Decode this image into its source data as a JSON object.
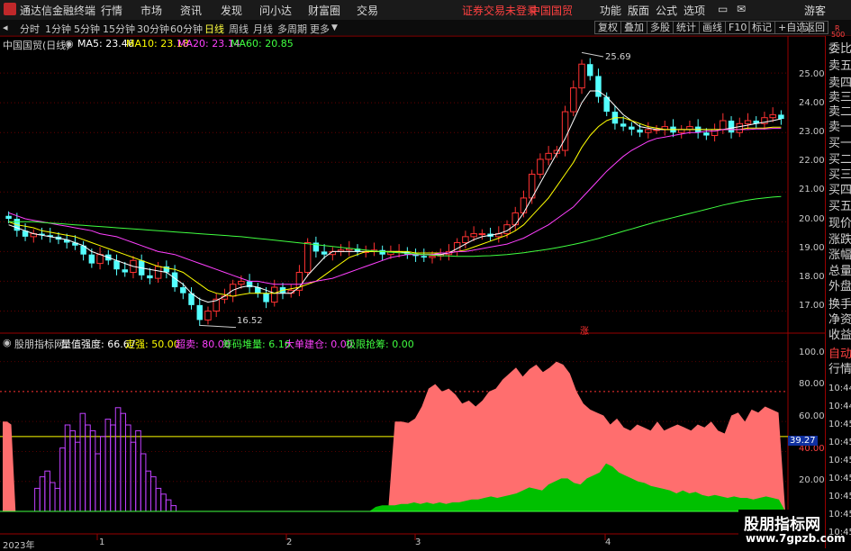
{
  "titlebar": {
    "app_title": "通达信金融终端",
    "menu": [
      "行情",
      "市场",
      "资讯",
      "发现",
      "问小达",
      "财富圈",
      "交易"
    ],
    "login_status": "证券交易未登录",
    "stock_name": "中国国贸",
    "right_menu": [
      "功能",
      "版面",
      "公式",
      "选项"
    ],
    "guest": "游客"
  },
  "periodbar": {
    "periods": [
      "分时",
      "1分钟",
      "5分钟",
      "15分钟",
      "30分钟",
      "60分钟",
      "日线",
      "周线",
      "月线",
      "多周期",
      "更多"
    ],
    "selected": "日线",
    "tools": [
      "复权",
      "叠加",
      "多股",
      "统计",
      "画线",
      "F10",
      "标记",
      "+自选",
      "返回"
    ]
  },
  "main_chart_header": {
    "title": "中国国贸(日线)",
    "ma": [
      {
        "label": "MA5: 23.46",
        "color": "#ffffff"
      },
      {
        "label": "MA10: 23.18",
        "color": "#ffff00"
      },
      {
        "label": "MA20: 23.14",
        "color": "#ff40ff"
      },
      {
        "label": "MA60: 20.85",
        "color": "#40ff40"
      }
    ]
  },
  "indicator_header": {
    "name": "股朋指标网",
    "items": [
      {
        "label": "量值强度: 66.67",
        "color": "#ffffff"
      },
      {
        "label": "走强: 50.00",
        "color": "#ffff00"
      },
      {
        "label": "超卖: 80.00",
        "color": "#ff40ff"
      },
      {
        "label": "筹码堆量: 6.16",
        "color": "#40ff40"
      },
      {
        "label": "大单建仓: 0.00",
        "color": "#ff40ff"
      },
      {
        "label": "极限抢筹: 0.00",
        "color": "#40ff40"
      }
    ]
  },
  "price_axis": [
    "25.00",
    "24.00",
    "23.00",
    "22.00",
    "21.00",
    "20.00",
    "19.00",
    "18.00",
    "17.00"
  ],
  "indicator_axis": [
    "100.0",
    "80.00",
    "60.00",
    "40.00",
    "20.00"
  ],
  "indicator_axis_highlight": "39.27",
  "high_label": "25.69",
  "low_label": "16.52",
  "zhang_marker": "涨",
  "date_axis": [
    "2023年",
    "1",
    "2",
    "3",
    "4"
  ],
  "right_panel": [
    "委比",
    "卖五",
    "卖四",
    "卖三",
    "卖二",
    "卖一",
    "买一",
    "买二",
    "买三",
    "买四",
    "买五",
    "现价",
    "涨跌",
    "涨幅",
    "总量",
    "外盘",
    "换手",
    "净资",
    "收益"
  ],
  "right_panel_lower": [
    "自动",
    "行情"
  ],
  "right_panel_times": [
    "10:44",
    "10:44",
    "10:45",
    "10:45",
    "10:45",
    "10:45",
    "10:45",
    "10:45",
    "10:45"
  ],
  "r_badge": "R",
  "r_badge_num": "500",
  "watermark": {
    "title": "股朋指标网",
    "url": "www.7gpzb.com"
  },
  "colors": {
    "up": "#ff3232",
    "down": "#54ffff",
    "ma5": "#ffffff",
    "ma10": "#ffff00",
    "ma20": "#ff40ff",
    "ma60": "#40ff40",
    "accent": "#900000"
  },
  "chart_data": {
    "type": "candlestick",
    "ylim": [
      16.5,
      25.7
    ],
    "close": [
      20.1,
      19.7,
      19.5,
      19.6,
      19.55,
      19.5,
      19.4,
      19.3,
      19.2,
      18.9,
      18.6,
      18.9,
      18.7,
      18.4,
      18.3,
      18.7,
      18.2,
      18.1,
      18.5,
      18.3,
      17.8,
      17.6,
      17.2,
      16.7,
      17.0,
      17.4,
      17.5,
      17.9,
      18.0,
      17.8,
      17.6,
      17.3,
      17.8,
      17.6,
      17.7,
      18.3,
      19.3,
      19.0,
      18.9,
      19.0,
      19.05,
      19.1,
      19.0,
      19.0,
      19.05,
      18.9,
      19.0,
      19.0,
      18.9,
      18.85,
      18.8,
      18.85,
      18.9,
      19.0,
      19.3,
      19.5,
      19.6,
      19.6,
      19.5,
      19.6,
      19.9,
      20.3,
      20.8,
      21.6,
      22.1,
      22.3,
      22.4,
      23.7,
      24.5,
      25.3,
      24.9,
      24.2,
      23.7,
      23.3,
      23.2,
      23.1,
      23.0,
      23.1,
      23.1,
      23.2,
      23.0,
      23.1,
      23.2,
      23.0,
      22.9,
      23.1,
      23.4,
      23.0,
      23.3,
      23.4,
      23.3,
      23.5,
      23.6,
      23.46
    ],
    "series": [
      {
        "name": "MA5",
        "values": [
          19.9,
          19.8,
          19.7,
          19.6,
          19.55,
          19.5,
          19.45,
          19.4,
          19.3,
          19.2,
          19.0,
          18.9,
          18.8,
          18.7,
          18.6,
          18.5,
          18.45,
          18.4,
          18.35,
          18.3,
          18.1,
          17.9,
          17.6,
          17.4,
          17.3,
          17.35,
          17.5,
          17.7,
          17.8,
          17.85,
          17.8,
          17.7,
          17.6,
          17.6,
          17.6,
          17.8,
          18.2,
          18.5,
          18.8,
          19.0,
          19.0,
          19.0,
          19.0,
          19.0,
          19.0,
          19.0,
          19.0,
          19.0,
          18.95,
          18.9,
          18.9,
          18.9,
          18.9,
          18.95,
          19.1,
          19.25,
          19.4,
          19.5,
          19.55,
          19.6,
          19.7,
          19.9,
          20.3,
          20.8,
          21.3,
          21.8,
          22.3,
          22.8,
          23.4,
          24.0,
          24.4,
          24.4,
          24.2,
          23.9,
          23.6,
          23.4,
          23.2,
          23.15,
          23.1,
          23.1,
          23.1,
          23.1,
          23.1,
          23.1,
          23.1,
          23.1,
          23.1,
          23.15,
          23.2,
          23.25,
          23.3,
          23.35,
          23.4,
          23.46
        ]
      },
      {
        "name": "MA10",
        "values": [
          20.0,
          19.9,
          19.85,
          19.8,
          19.7,
          19.65,
          19.6,
          19.55,
          19.5,
          19.4,
          19.3,
          19.2,
          19.1,
          19.0,
          18.9,
          18.8,
          18.7,
          18.6,
          18.5,
          18.45,
          18.4,
          18.3,
          18.1,
          17.9,
          17.7,
          17.6,
          17.55,
          17.5,
          17.55,
          17.6,
          17.6,
          17.6,
          17.6,
          17.7,
          17.75,
          17.8,
          17.9,
          18.0,
          18.2,
          18.4,
          18.6,
          18.8,
          18.9,
          19.0,
          19.0,
          19.0,
          19.0,
          19.0,
          19.0,
          18.95,
          18.95,
          18.95,
          18.95,
          18.95,
          19.0,
          19.05,
          19.15,
          19.25,
          19.35,
          19.45,
          19.55,
          19.7,
          19.9,
          20.2,
          20.5,
          20.8,
          21.2,
          21.6,
          22.0,
          22.5,
          22.9,
          23.2,
          23.4,
          23.5,
          23.5,
          23.4,
          23.3,
          23.2,
          23.15,
          23.1,
          23.1,
          23.1,
          23.1,
          23.1,
          23.1,
          23.1,
          23.1,
          23.1,
          23.1,
          23.15,
          23.15,
          23.15,
          23.18,
          23.18
        ]
      },
      {
        "name": "MA20",
        "values": [
          20.3,
          20.2,
          20.1,
          20.05,
          20.0,
          19.95,
          19.9,
          19.85,
          19.8,
          19.75,
          19.7,
          19.6,
          19.55,
          19.5,
          19.4,
          19.3,
          19.2,
          19.1,
          19.0,
          18.95,
          18.9,
          18.8,
          18.7,
          18.6,
          18.5,
          18.4,
          18.3,
          18.2,
          18.1,
          18.0,
          18.0,
          17.95,
          17.9,
          17.9,
          17.9,
          17.9,
          17.95,
          18.0,
          18.05,
          18.1,
          18.2,
          18.3,
          18.4,
          18.5,
          18.6,
          18.7,
          18.8,
          18.85,
          18.9,
          18.9,
          18.9,
          18.9,
          18.95,
          18.95,
          19.0,
          19.0,
          19.05,
          19.1,
          19.15,
          19.2,
          19.25,
          19.35,
          19.45,
          19.6,
          19.75,
          19.9,
          20.1,
          20.3,
          20.5,
          20.8,
          21.1,
          21.4,
          21.7,
          21.95,
          22.2,
          22.4,
          22.55,
          22.7,
          22.8,
          22.85,
          22.9,
          22.95,
          23.0,
          23.0,
          23.05,
          23.05,
          23.1,
          23.1,
          23.1,
          23.1,
          23.12,
          23.12,
          23.14,
          23.14
        ]
      },
      {
        "name": "MA60",
        "values": [
          20.0,
          20.0,
          20.0,
          20.0,
          19.98,
          19.96,
          19.94,
          19.92,
          19.9,
          19.88,
          19.86,
          19.84,
          19.82,
          19.8,
          19.78,
          19.76,
          19.74,
          19.72,
          19.7,
          19.68,
          19.66,
          19.64,
          19.62,
          19.6,
          19.58,
          19.56,
          19.54,
          19.52,
          19.5,
          19.47,
          19.44,
          19.41,
          19.38,
          19.35,
          19.32,
          19.29,
          19.26,
          19.23,
          19.2,
          19.17,
          19.14,
          19.11,
          19.08,
          19.05,
          19.02,
          19.0,
          18.98,
          18.96,
          18.94,
          18.92,
          18.9,
          18.88,
          18.86,
          18.85,
          18.84,
          18.84,
          18.84,
          18.85,
          18.86,
          18.88,
          18.9,
          18.93,
          18.96,
          19.0,
          19.04,
          19.08,
          19.13,
          19.18,
          19.24,
          19.3,
          19.37,
          19.44,
          19.52,
          19.6,
          19.68,
          19.76,
          19.84,
          19.92,
          20.0,
          20.07,
          20.14,
          20.21,
          20.28,
          20.35,
          20.42,
          20.49,
          20.56,
          20.62,
          20.68,
          20.73,
          20.77,
          20.8,
          20.83,
          20.85
        ]
      }
    ],
    "indicator": {
      "ylim": [
        0,
        110
      ],
      "red_area": [
        0,
        0,
        0,
        0,
        0,
        0,
        0,
        0,
        0,
        0,
        0,
        0,
        0,
        0,
        0,
        0,
        0,
        0,
        0,
        0,
        0,
        0,
        0,
        0,
        0,
        0,
        0,
        0,
        0,
        0,
        0,
        0,
        0,
        0,
        0,
        0,
        0,
        0,
        0,
        0,
        0,
        0,
        0,
        0,
        0,
        0,
        0,
        0,
        0,
        0,
        0,
        0,
        0,
        0,
        0,
        0,
        0,
        0,
        60,
        60,
        59,
        62,
        70,
        82,
        85,
        80,
        82,
        78,
        72,
        74,
        70,
        74,
        80,
        82,
        88,
        92,
        96,
        90,
        95,
        98,
        93,
        96,
        100,
        98,
        92,
        80,
        72,
        68,
        66,
        64,
        58,
        62,
        56,
        54,
        58,
        56,
        54,
        60,
        54,
        56,
        58,
        56,
        54,
        58,
        56,
        60,
        54,
        52,
        64,
        66,
        60,
        68,
        66,
        70,
        68,
        66
      ],
      "green_area": [
        0,
        0,
        0,
        0,
        0,
        0,
        0,
        0,
        0,
        0,
        0,
        0,
        0,
        0,
        0,
        0,
        0,
        0,
        0,
        0,
        0,
        0,
        0,
        0,
        0,
        0,
        0,
        0,
        0,
        0,
        0,
        0,
        0,
        0,
        0,
        0,
        0,
        0,
        0,
        0,
        0,
        0,
        0,
        0,
        0,
        0,
        0,
        0,
        0,
        0,
        0,
        0,
        0,
        0,
        0,
        0,
        0,
        0,
        3,
        4,
        4,
        4,
        5,
        5,
        6,
        5,
        6,
        5,
        6,
        5,
        6,
        6,
        7,
        8,
        8,
        9,
        10,
        9,
        10,
        11,
        12,
        14,
        16,
        15,
        14,
        18,
        20,
        22,
        22,
        19,
        18,
        22,
        24,
        26,
        32,
        30,
        26,
        24,
        22,
        20,
        19,
        17,
        16,
        15,
        14,
        12,
        14,
        12,
        13,
        11,
        10,
        11,
        10,
        9,
        10,
        9,
        9,
        8,
        9,
        10,
        9,
        8
      ],
      "purple_bars": [
        0,
        0,
        0,
        0,
        0,
        0,
        8,
        12,
        14,
        10,
        8,
        22,
        30,
        28,
        24,
        34,
        30,
        28,
        20,
        26,
        32,
        30,
        36,
        34,
        30,
        24,
        28,
        20,
        14,
        12,
        8,
        6,
        4,
        2,
        0,
        0,
        0,
        0,
        0,
        0,
        0,
        0,
        0,
        0,
        0,
        0,
        0,
        0,
        0,
        0,
        0,
        0,
        0,
        0,
        0,
        0,
        0,
        0
      ],
      "left_red": [
        60,
        60,
        58,
        0
      ]
    }
  }
}
